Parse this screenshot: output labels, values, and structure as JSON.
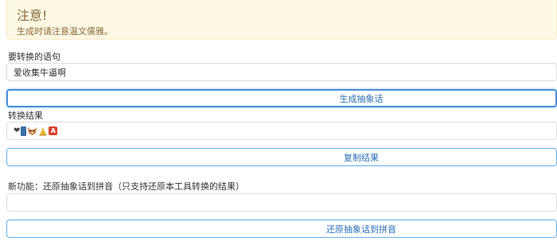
{
  "alert": {
    "title": "注意!",
    "text": "生成时请注意温文儒雅。"
  },
  "input_section": {
    "label": "要转换的语句",
    "value": "爱收集牛逼啊"
  },
  "generate_button": {
    "label": "生成抽象话"
  },
  "result_section": {
    "label": "转换结果",
    "emojis": [
      "heart-icon",
      "blue-block-icon",
      "fox-icon",
      "sun-bell-icon",
      "letter-a-icon"
    ],
    "heart_glyph": "❤",
    "a_glyph": "A"
  },
  "copy_button": {
    "label": "复制结果"
  },
  "restore_section": {
    "label": "新功能：还原抽象话到拼音（只支持还原本工具转换的结果）",
    "value": ""
  },
  "restore_button": {
    "label": "还原抽象话到拼音"
  },
  "colors": {
    "alert_bg": "#fcf8e3",
    "alert_text": "#8a6d3b",
    "button_border": "#66afe9",
    "button_text": "#2a6fb5"
  }
}
